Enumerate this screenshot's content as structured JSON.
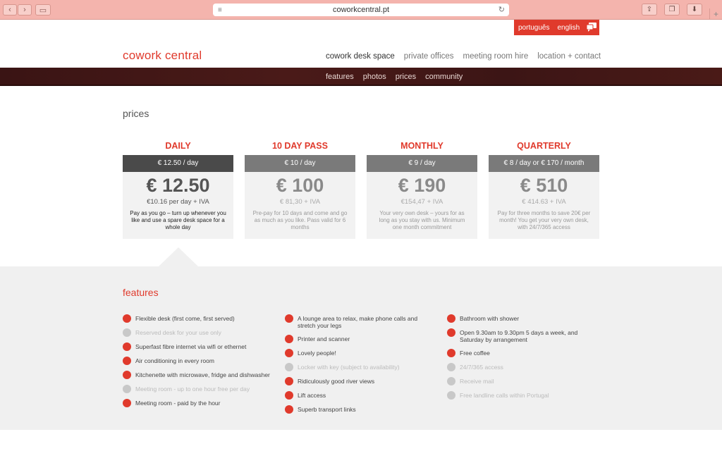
{
  "browser": {
    "url": "coworkcentral.pt"
  },
  "languages": {
    "pt": "português",
    "en": "english"
  },
  "site": {
    "logo": "cowork central",
    "mainnav": [
      "cowork desk space",
      "private offices",
      "meeting room hire",
      "location + contact"
    ],
    "active_nav": 0,
    "subnav": [
      "features",
      "photos",
      "prices",
      "community"
    ]
  },
  "prices": {
    "title": "prices",
    "cards": [
      {
        "category": "DAILY",
        "bar": "€ 12.50 / day",
        "big": "€ 12.50",
        "perday": "€10.16 per day + IVA",
        "desc": "Pay as you go – turn up whenever you like and use a spare desk space for a whole day"
      },
      {
        "category": "10 DAY PASS",
        "bar": "€ 10 / day",
        "big": "€ 100",
        "perday": "€ 81,30 + IVA",
        "desc": "Pre-pay for 10 days and come and go as much as you like. Pass valid for 6 months"
      },
      {
        "category": "MONTHLY",
        "bar": "€ 9 / day",
        "big": "€ 190",
        "perday": "€154,47 + IVA",
        "desc": "Your very own desk – yours for as long as you stay with us. Minimum one month commitment"
      },
      {
        "category": "QUARTERLY",
        "bar": "€ 8 / day or € 170 / month",
        "big": "€ 510",
        "perday": "€ 414.63 + IVA",
        "desc": "Pay for three months to save 20€ per month! You get your very own desk, with 24/7/365 access"
      }
    ]
  },
  "features": {
    "title": "features",
    "columns": [
      [
        {
          "text": "Flexible desk (first come, first served)",
          "included": true
        },
        {
          "text": "Reserved desk for your use only",
          "included": false
        },
        {
          "text": "Superfast fibre internet via wifi or ethernet",
          "included": true
        },
        {
          "text": "Air conditioning in every room",
          "included": true
        },
        {
          "text": "Kitchenette with microwave, fridge and dishwasher",
          "included": true
        },
        {
          "text": "Meeting room - up to one hour free per day",
          "included": false
        },
        {
          "text": "Meeting room - paid by the hour",
          "included": true
        }
      ],
      [
        {
          "text": "A lounge area to relax, make phone calls and stretch your legs",
          "included": true
        },
        {
          "text": "Printer and scanner",
          "included": true
        },
        {
          "text": "Lovely people!",
          "included": true
        },
        {
          "text": "Locker with key (subject to availability)",
          "included": false
        },
        {
          "text": "Ridiculously good river views",
          "included": true
        },
        {
          "text": "Lift access",
          "included": true
        },
        {
          "text": "Superb transport links",
          "included": true
        }
      ],
      [
        {
          "text": "Bathroom with shower",
          "included": true
        },
        {
          "text": "Open 9.30am to 9.30pm 5 days a week, and Saturday by arrangement",
          "included": true
        },
        {
          "text": "Free coffee",
          "included": true
        },
        {
          "text": "24/7/365 access",
          "included": false
        },
        {
          "text": "Receive mail",
          "included": false
        },
        {
          "text": "Free landline calls within Portugal",
          "included": false
        }
      ]
    ]
  }
}
